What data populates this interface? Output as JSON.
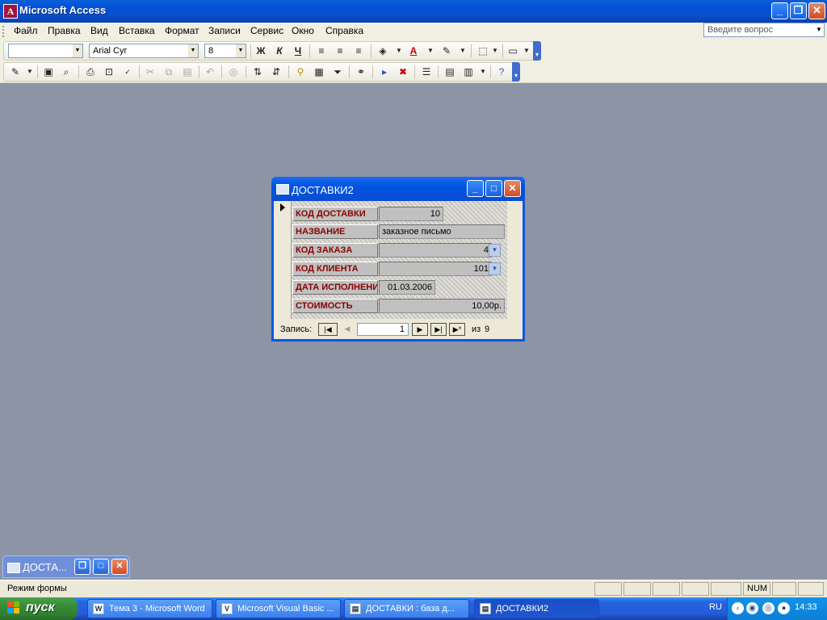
{
  "app": {
    "title": "Microsoft Access"
  },
  "menu": {
    "items": [
      "Файл",
      "Правка",
      "Вид",
      "Вставка",
      "Формат",
      "Записи",
      "Сервис",
      "Окно",
      "Справка"
    ]
  },
  "ask": {
    "placeholder": "Введите вопрос"
  },
  "formatting": {
    "object": "",
    "font": "Arial Cyr",
    "size": "8",
    "bold": "Ж",
    "italic": "К",
    "underline": "Ч"
  },
  "form": {
    "title": "ДОСТАВКИ2",
    "fields": [
      {
        "label": "КОД ДОСТАВКИ",
        "value": "10"
      },
      {
        "label": "НАЗВАНИЕ",
        "value": "заказное письмо"
      },
      {
        "label": "КОД ЗАКАЗА",
        "value": "4"
      },
      {
        "label": "КОД КЛИЕНТА",
        "value": "101"
      },
      {
        "label": "ДАТА ИСПОЛНЕНИ",
        "value": "01.03.2006"
      },
      {
        "label": "СТОИМОСТЬ",
        "value": "10,00р."
      }
    ],
    "nav": {
      "label": "Запись:",
      "current": "1",
      "of_label": "из",
      "total": "9"
    }
  },
  "minimized": {
    "label": "ДОСТА..."
  },
  "status": {
    "text": "Режим формы",
    "num": "NUM"
  },
  "taskbar": {
    "start": "пуск",
    "buttons": [
      {
        "label": "Тема 3 - Microsoft Word",
        "icon": "word-icon"
      },
      {
        "label": "Microsoft Visual Basic ...",
        "icon": "vba-icon"
      },
      {
        "label": "ДОСТАВКИ : база д...",
        "icon": "access-db-icon"
      },
      {
        "label": "ДОСТАВКИ2",
        "icon": "form-icon"
      }
    ],
    "lang": "RU",
    "clock": "14:33"
  },
  "colors": {
    "field_label": "#8b0000",
    "titlebar": "#0054e3",
    "desktop": "#8d94a5"
  }
}
